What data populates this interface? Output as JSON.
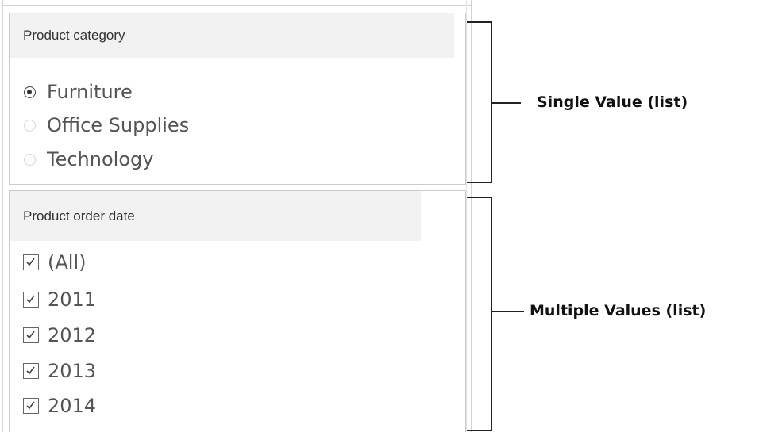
{
  "single_value_filter": {
    "title": "Product category",
    "options": [
      {
        "label": "Furniture",
        "selected": true
      },
      {
        "label": "Office Supplies",
        "selected": false
      },
      {
        "label": "Technology",
        "selected": false
      }
    ]
  },
  "multiple_values_filter": {
    "title": "Product order date",
    "options": [
      {
        "label": "(All)",
        "checked": true
      },
      {
        "label": "2011",
        "checked": true
      },
      {
        "label": "2012",
        "checked": true
      },
      {
        "label": "2013",
        "checked": true
      },
      {
        "label": "2014",
        "checked": true
      }
    ]
  },
  "annotations": {
    "single": "Single Value (list)",
    "multiple": "Multiple Values (list)"
  },
  "colors": {
    "header_bg": "#f2f2f2",
    "text": "#555555",
    "bracket": "#222222"
  }
}
